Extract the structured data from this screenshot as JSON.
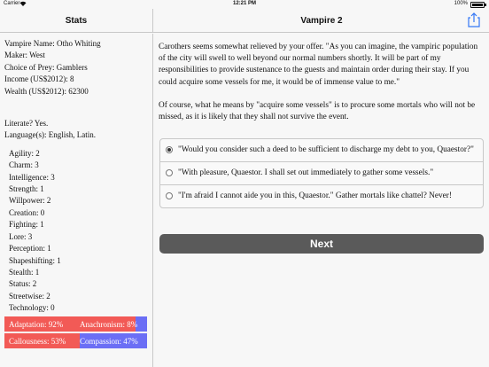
{
  "status": {
    "carrier": "Carrier",
    "time": "12:21 PM",
    "battery": "100%"
  },
  "nav": {
    "left_title": "Stats",
    "right_title": "Vampire 2"
  },
  "stats": {
    "info": [
      "Vampire Name: Otho Whiting",
      "Maker: West",
      "Choice of Prey: Gamblers",
      "Income (US$2012): 8",
      "Wealth (US$2012): 62300"
    ],
    "literacy": [
      "Literate? Yes.",
      "Language(s): English, Latin."
    ],
    "attributes": [
      "Agility: 2",
      "Charm: 3",
      "Intelligence: 3",
      "Strength: 1",
      "Willpower: 2",
      "Creation: 0",
      "Fighting: 1",
      "Lore: 3",
      "Perception: 1",
      "Shapeshifting: 1",
      "Stealth: 1",
      "Status: 2",
      "Streetwise: 2",
      "Technology: 0"
    ],
    "bars": [
      {
        "left": "Adaptation: 92%",
        "right": "Anachronism: 8%",
        "left_pct": 92
      },
      {
        "left": "Callousness: 53%",
        "right": "Compassion: 47%",
        "left_pct": 53
      }
    ]
  },
  "story": {
    "p1": "Carothers seems somewhat relieved by your offer. \"As you can imagine, the vampiric population of the city will swell to well beyond our normal numbers shortly. It will be part of my responsibilities to provide sustenance to the guests and maintain order during their stay. If you could acquire some vessels for me, it would be of immense value to me.\"",
    "p2": "Of course, what he means by \"acquire some vessels\" is to procure some mortals who will not be missed, as it is likely that they shall not survive the event.",
    "choices": [
      "\"Would you consider such a deed to be sufficient to discharge my debt to you, Quaestor?\"",
      "\"With pleasure, Quaestor. I shall set out immediately to gather some vessels.\"",
      "\"I'm afraid I cannot aide you in this, Quaestor.\" Gather mortals like chattel? Never!"
    ],
    "selected_choice": 0,
    "next_label": "Next"
  }
}
